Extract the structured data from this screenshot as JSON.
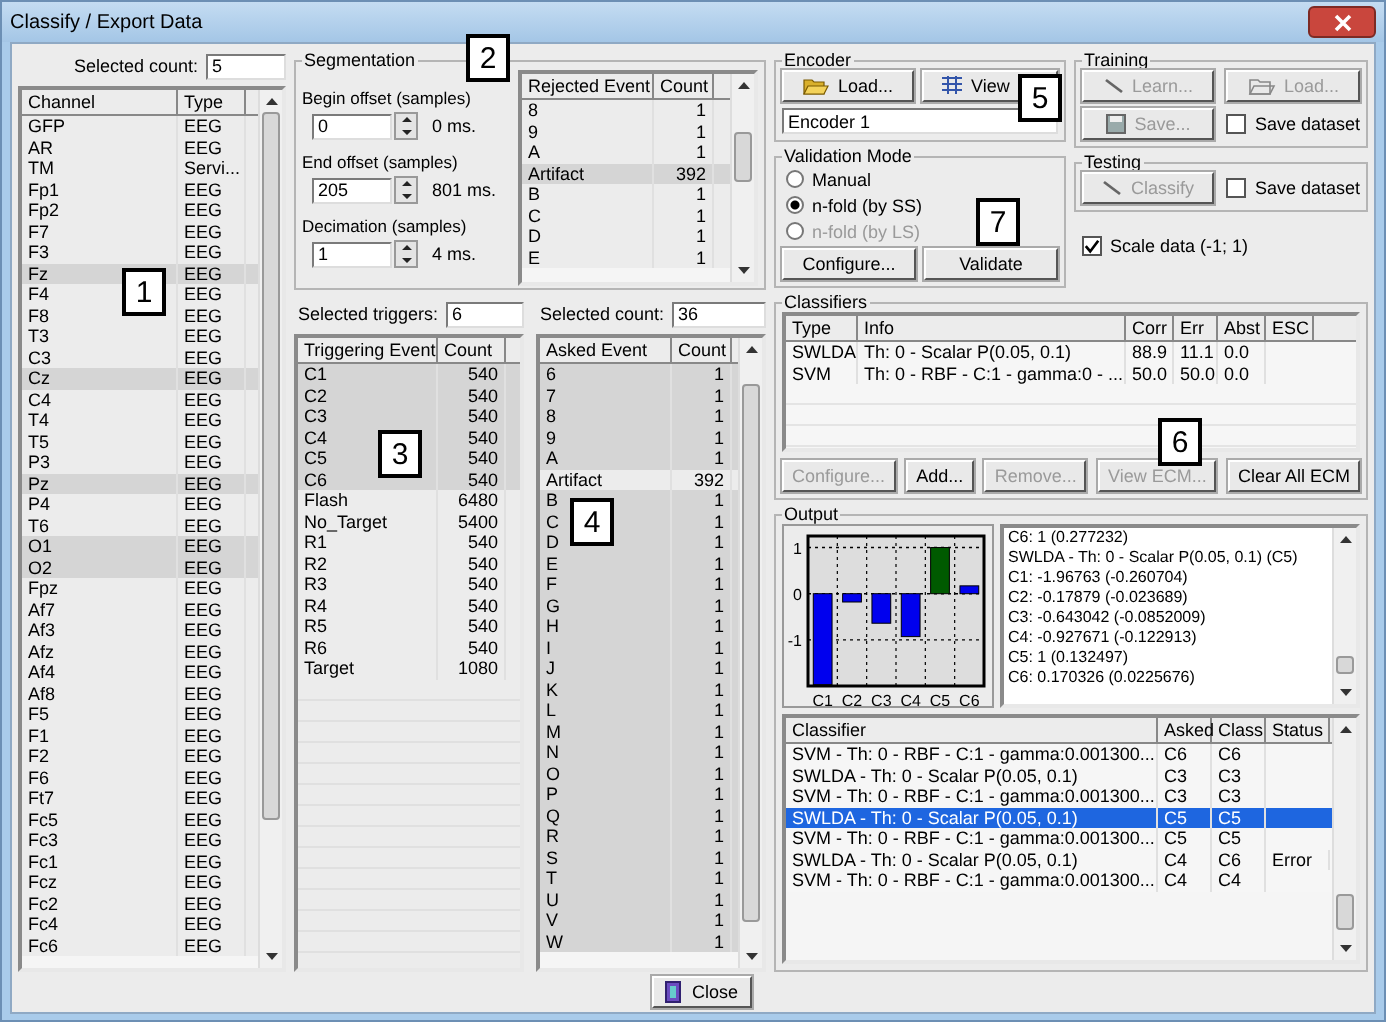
{
  "window": {
    "title": "Classify / Export Data"
  },
  "channels": {
    "label": "Selected count:",
    "value": "5",
    "columns": [
      "Channel",
      "Type"
    ],
    "rows": [
      {
        "name": "GFP",
        "type": "EEG",
        "selected": false
      },
      {
        "name": "AR",
        "type": "EEG",
        "selected": false
      },
      {
        "name": "TM",
        "type": "Servi...",
        "selected": false
      },
      {
        "name": "Fp1",
        "type": "EEG",
        "selected": false
      },
      {
        "name": "Fp2",
        "type": "EEG",
        "selected": false
      },
      {
        "name": "F7",
        "type": "EEG",
        "selected": false
      },
      {
        "name": "F3",
        "type": "EEG",
        "selected": false
      },
      {
        "name": "Fz",
        "type": "EEG",
        "selected": true
      },
      {
        "name": "F4",
        "type": "EEG",
        "selected": false
      },
      {
        "name": "F8",
        "type": "EEG",
        "selected": false
      },
      {
        "name": "T3",
        "type": "EEG",
        "selected": false
      },
      {
        "name": "C3",
        "type": "EEG",
        "selected": false
      },
      {
        "name": "Cz",
        "type": "EEG",
        "selected": true
      },
      {
        "name": "C4",
        "type": "EEG",
        "selected": false
      },
      {
        "name": "T4",
        "type": "EEG",
        "selected": false
      },
      {
        "name": "T5",
        "type": "EEG",
        "selected": false
      },
      {
        "name": "P3",
        "type": "EEG",
        "selected": false
      },
      {
        "name": "Pz",
        "type": "EEG",
        "selected": true
      },
      {
        "name": "P4",
        "type": "EEG",
        "selected": false
      },
      {
        "name": "T6",
        "type": "EEG",
        "selected": false
      },
      {
        "name": "O1",
        "type": "EEG",
        "selected": true
      },
      {
        "name": "O2",
        "type": "EEG",
        "selected": true
      },
      {
        "name": "Fpz",
        "type": "EEG",
        "selected": false
      },
      {
        "name": "Af7",
        "type": "EEG",
        "selected": false
      },
      {
        "name": "Af3",
        "type": "EEG",
        "selected": false
      },
      {
        "name": "Afz",
        "type": "EEG",
        "selected": false
      },
      {
        "name": "Af4",
        "type": "EEG",
        "selected": false
      },
      {
        "name": "Af8",
        "type": "EEG",
        "selected": false
      },
      {
        "name": "F5",
        "type": "EEG",
        "selected": false
      },
      {
        "name": "F1",
        "type": "EEG",
        "selected": false
      },
      {
        "name": "F2",
        "type": "EEG",
        "selected": false
      },
      {
        "name": "F6",
        "type": "EEG",
        "selected": false
      },
      {
        "name": "Ft7",
        "type": "EEG",
        "selected": false
      },
      {
        "name": "Fc5",
        "type": "EEG",
        "selected": false
      },
      {
        "name": "Fc3",
        "type": "EEG",
        "selected": false
      },
      {
        "name": "Fc1",
        "type": "EEG",
        "selected": false
      },
      {
        "name": "Fcz",
        "type": "EEG",
        "selected": false
      },
      {
        "name": "Fc2",
        "type": "EEG",
        "selected": false
      },
      {
        "name": "Fc4",
        "type": "EEG",
        "selected": false
      },
      {
        "name": "Fc6",
        "type": "EEG",
        "selected": false
      }
    ]
  },
  "segmentation": {
    "title": "Segmentation",
    "fields": [
      {
        "label": "Begin offset (samples)",
        "value": "0",
        "reading": "0 ms."
      },
      {
        "label": "End offset (samples)",
        "value": "205",
        "reading": "801 ms."
      },
      {
        "label": "Decimation (samples)",
        "value": "1",
        "reading": "4 ms."
      }
    ],
    "rejected": {
      "columns": [
        "Rejected Event",
        "Count"
      ],
      "rows": [
        {
          "event": "8",
          "count": "1",
          "selected": false
        },
        {
          "event": "9",
          "count": "1",
          "selected": false
        },
        {
          "event": "A",
          "count": "1",
          "selected": false
        },
        {
          "event": "Artifact",
          "count": "392",
          "selected": true
        },
        {
          "event": "B",
          "count": "1",
          "selected": false
        },
        {
          "event": "C",
          "count": "1",
          "selected": false
        },
        {
          "event": "D",
          "count": "1",
          "selected": false
        },
        {
          "event": "E",
          "count": "1",
          "selected": false
        }
      ]
    }
  },
  "triggers": {
    "label": "Selected triggers:",
    "value": "6",
    "columns": [
      "Triggering Event",
      "Count"
    ],
    "rows": [
      {
        "event": "C1",
        "count": "540",
        "selected": true
      },
      {
        "event": "C2",
        "count": "540",
        "selected": true
      },
      {
        "event": "C3",
        "count": "540",
        "selected": true
      },
      {
        "event": "C4",
        "count": "540",
        "selected": true
      },
      {
        "event": "C5",
        "count": "540",
        "selected": true
      },
      {
        "event": "C6",
        "count": "540",
        "selected": true
      },
      {
        "event": "Flash",
        "count": "6480",
        "selected": false
      },
      {
        "event": "No_Target",
        "count": "5400",
        "selected": false
      },
      {
        "event": "R1",
        "count": "540",
        "selected": false
      },
      {
        "event": "R2",
        "count": "540",
        "selected": false
      },
      {
        "event": "R3",
        "count": "540",
        "selected": false
      },
      {
        "event": "R4",
        "count": "540",
        "selected": false
      },
      {
        "event": "R5",
        "count": "540",
        "selected": false
      },
      {
        "event": "R6",
        "count": "540",
        "selected": false
      },
      {
        "event": "Target",
        "count": "1080",
        "selected": false
      }
    ]
  },
  "asked": {
    "label": "Selected count:",
    "value": "36",
    "columns": [
      "Asked Event",
      "Count"
    ],
    "rows": [
      {
        "event": "6",
        "count": "1",
        "selected": true
      },
      {
        "event": "7",
        "count": "1",
        "selected": true
      },
      {
        "event": "8",
        "count": "1",
        "selected": true
      },
      {
        "event": "9",
        "count": "1",
        "selected": true
      },
      {
        "event": "A",
        "count": "1",
        "selected": true
      },
      {
        "event": "Artifact",
        "count": "392",
        "selected": false
      },
      {
        "event": "B",
        "count": "1",
        "selected": true
      },
      {
        "event": "C",
        "count": "1",
        "selected": true
      },
      {
        "event": "D",
        "count": "1",
        "selected": true
      },
      {
        "event": "E",
        "count": "1",
        "selected": true
      },
      {
        "event": "F",
        "count": "1",
        "selected": true
      },
      {
        "event": "G",
        "count": "1",
        "selected": true
      },
      {
        "event": "H",
        "count": "1",
        "selected": true
      },
      {
        "event": "I",
        "count": "1",
        "selected": true
      },
      {
        "event": "J",
        "count": "1",
        "selected": true
      },
      {
        "event": "K",
        "count": "1",
        "selected": true
      },
      {
        "event": "L",
        "count": "1",
        "selected": true
      },
      {
        "event": "M",
        "count": "1",
        "selected": true
      },
      {
        "event": "N",
        "count": "1",
        "selected": true
      },
      {
        "event": "O",
        "count": "1",
        "selected": true
      },
      {
        "event": "P",
        "count": "1",
        "selected": true
      },
      {
        "event": "Q",
        "count": "1",
        "selected": true
      },
      {
        "event": "R",
        "count": "1",
        "selected": true
      },
      {
        "event": "S",
        "count": "1",
        "selected": true
      },
      {
        "event": "T",
        "count": "1",
        "selected": true
      },
      {
        "event": "U",
        "count": "1",
        "selected": true
      },
      {
        "event": "V",
        "count": "1",
        "selected": true
      },
      {
        "event": "W",
        "count": "1",
        "selected": true
      }
    ]
  },
  "encoder": {
    "title": "Encoder",
    "buttons": [
      {
        "label": "Load...",
        "disabled": false
      },
      {
        "label": "View",
        "disabled": false
      }
    ],
    "value": "Encoder 1"
  },
  "training": {
    "title": "Training",
    "buttons": [
      {
        "label": "Learn...",
        "disabled": true
      },
      {
        "label": "Load...",
        "disabled": true
      },
      {
        "label": "Save...",
        "disabled": true
      }
    ],
    "checkbox": {
      "label": "Save dataset",
      "checked": false
    }
  },
  "validation": {
    "title": "Validation Mode",
    "options": [
      {
        "label": "Manual",
        "selected": false,
        "disabled": false
      },
      {
        "label": "n-fold (by SS)",
        "selected": true,
        "disabled": false
      },
      {
        "label": "n-fold (by LS)",
        "selected": false,
        "disabled": true
      }
    ],
    "buttons": [
      {
        "label": "Configure...",
        "disabled": false
      },
      {
        "label": "Validate",
        "disabled": false
      }
    ]
  },
  "testing": {
    "title": "Testing",
    "button": {
      "label": "Classify",
      "disabled": true
    },
    "checkbox": {
      "label": "Save dataset",
      "checked": false
    }
  },
  "scale": {
    "label": "Scale data (-1; 1)",
    "checked": true
  },
  "classifiers": {
    "title": "Classifiers",
    "columns": [
      "Type",
      "Info",
      "Corr",
      "Err",
      "Abst",
      "ESC"
    ],
    "rows": [
      {
        "type": "SWLDA",
        "info": "Th: 0 - Scalar P(0.05, 0.1)",
        "corr": "88.9",
        "err": "11.1",
        "abst": "0.0"
      },
      {
        "type": "SVM",
        "info": "Th: 0 - RBF - C:1 - gamma:0 - ...",
        "corr": "50.0",
        "err": "50.0",
        "abst": "0.0"
      }
    ],
    "buttons": [
      {
        "label": "Configure...",
        "disabled": true
      },
      {
        "label": "Add...",
        "disabled": false
      },
      {
        "label": "Remove...",
        "disabled": true
      },
      {
        "label": "View ECM...",
        "disabled": true
      },
      {
        "label": "Clear All ECM",
        "disabled": false
      }
    ]
  },
  "output": {
    "title": "Output",
    "chart_data": {
      "type": "bar",
      "categories": [
        "C1",
        "C2",
        "C3",
        "C4",
        "C5",
        "C6"
      ],
      "series": [
        {
          "color": "#0000ee",
          "values": [
            -1.97,
            -0.18,
            -0.64,
            -0.93,
            null,
            0.17
          ]
        },
        {
          "color": "#005a00",
          "values": [
            null,
            null,
            null,
            null,
            1,
            null
          ]
        }
      ],
      "ylim": [
        -2,
        1.25
      ],
      "yticks": [
        1,
        0,
        -1
      ],
      "grid": true
    },
    "log": [
      "C6: 1 (0.277232)",
      "SWLDA - Th: 0 - Scalar P(0.05, 0.1) (C5)",
      "C1: -1.96763 (-0.260704)",
      "C2: -0.17879 (-0.023689)",
      "C3: -0.643042 (-0.0852009)",
      "C4: -0.927671 (-0.122913)",
      "C5: 1 (0.132497)",
      "C6: 0.170326 (0.0225676)"
    ],
    "results": {
      "columns": [
        "Classifier",
        "Asked",
        "Class",
        "Status"
      ],
      "rows": [
        {
          "classifier": "SVM - Th: 0 - RBF - C:1 - gamma:0.001300...",
          "asked": "C6",
          "class": "C6",
          "selected": false
        },
        {
          "classifier": "SWLDA - Th: 0 - Scalar P(0.05, 0.1)",
          "asked": "C3",
          "class": "C3",
          "selected": false
        },
        {
          "classifier": "SVM - Th: 0 - RBF - C:1 - gamma:0.001300...",
          "asked": "C3",
          "class": "C3",
          "selected": false
        },
        {
          "classifier": "SWLDA - Th: 0 - Scalar P(0.05, 0.1)",
          "asked": "C5",
          "class": "C5",
          "selected": true
        },
        {
          "classifier": "SVM - Th: 0 - RBF - C:1 - gamma:0.001300...",
          "asked": "C5",
          "class": "C5",
          "selected": false
        },
        {
          "classifier": "SWLDA - Th: 0 - Scalar P(0.05, 0.1)",
          "asked": "C4",
          "class": "C6",
          "status": "Error",
          "selected": false
        },
        {
          "classifier": "SVM - Th: 0 - RBF - C:1 - gamma:0.001300...",
          "asked": "C4",
          "class": "C4",
          "selected": false
        }
      ]
    }
  },
  "close": {
    "label": "Close"
  },
  "callouts": [
    "1",
    "2",
    "3",
    "4",
    "5",
    "6",
    "7"
  ]
}
